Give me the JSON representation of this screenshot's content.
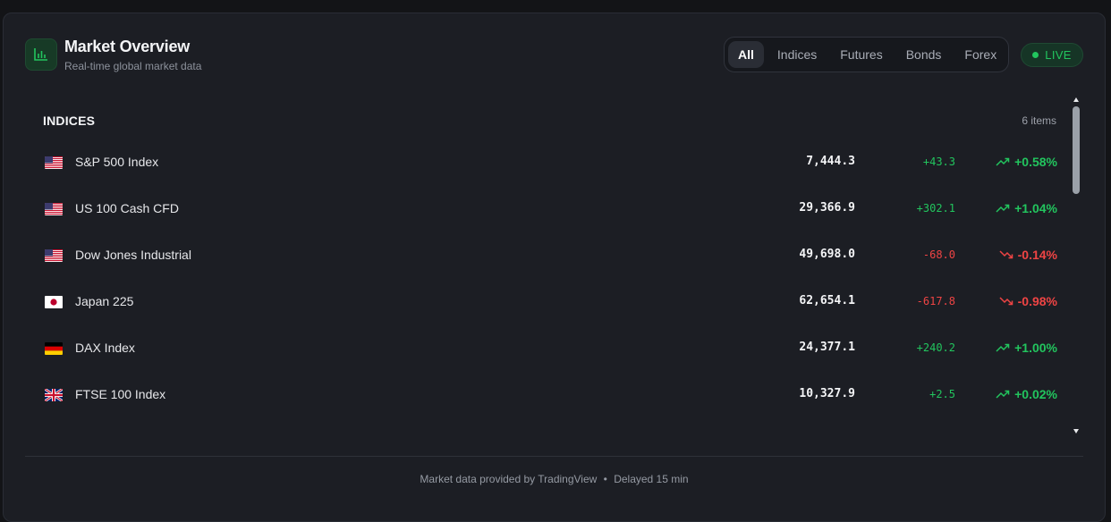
{
  "header": {
    "title": "Market Overview",
    "subtitle": "Real-time global market data",
    "logo_icon": "bar-chart-icon",
    "live_label": "LIVE"
  },
  "tabs": [
    {
      "label": "All",
      "active": true
    },
    {
      "label": "Indices",
      "active": false
    },
    {
      "label": "Futures",
      "active": false
    },
    {
      "label": "Bonds",
      "active": false
    },
    {
      "label": "Forex",
      "active": false
    }
  ],
  "section": {
    "title": "INDICES",
    "count": "6 items"
  },
  "rows": [
    {
      "flag": "us",
      "name": "S&P 500 Index",
      "price": "7,444.3",
      "change": "+43.3",
      "pct": "+0.58%",
      "direction": "up"
    },
    {
      "flag": "us",
      "name": "US 100 Cash CFD",
      "price": "29,366.9",
      "change": "+302.1",
      "pct": "+1.04%",
      "direction": "up"
    },
    {
      "flag": "us",
      "name": "Dow Jones Industrial",
      "price": "49,698.0",
      "change": "-68.0",
      "pct": "-0.14%",
      "direction": "down"
    },
    {
      "flag": "jp",
      "name": "Japan 225",
      "price": "62,654.1",
      "change": "-617.8",
      "pct": "-0.98%",
      "direction": "down"
    },
    {
      "flag": "de",
      "name": "DAX Index",
      "price": "24,377.1",
      "change": "+240.2",
      "pct": "+1.00%",
      "direction": "up"
    },
    {
      "flag": "gb",
      "name": "FTSE 100 Index",
      "price": "10,327.9",
      "change": "+2.5",
      "pct": "+0.02%",
      "direction": "up"
    }
  ],
  "footer": {
    "source": "Market data provided by TradingView",
    "separator": "•",
    "delay": "Delayed 15 min"
  },
  "colors": {
    "up": "#22c55e",
    "down": "#ef4444",
    "background": "#1c1e24"
  }
}
